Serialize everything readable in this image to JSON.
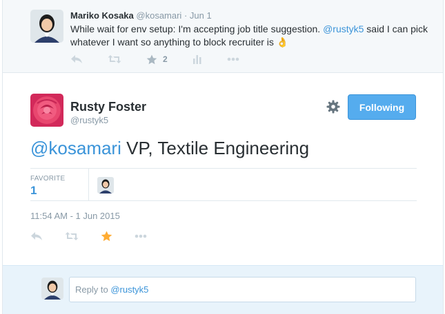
{
  "top_tweet": {
    "fullname": "Mariko Kosaka",
    "handle": "@kosamari",
    "separator": "·",
    "date": "Jun 1",
    "text_part1": "While wait for env setup: I'm accepting job title suggestion. ",
    "mention": "@rustyk5",
    "text_part2": " said I can pick whatever I want so anything to block recruiter is ",
    "emoji": "👌",
    "favorite_count": "2",
    "icons": [
      "reply-icon",
      "retweet-icon",
      "favorite-icon",
      "analytics-icon",
      "more-icon"
    ]
  },
  "main_tweet": {
    "fullname": "Rusty Foster",
    "handle": "@rustyk5",
    "follow_button": "Following",
    "text_mention": "@kosamari",
    "text_body": " VP, Textile Engineering",
    "favorite_label": "FAVORITE",
    "favorite_count": "1",
    "timestamp": "11:54 AM - 1 Jun 2015",
    "icons": [
      "reply-icon",
      "retweet-icon",
      "favorite-icon",
      "more-icon",
      "gear-icon"
    ]
  },
  "reply": {
    "placeholder": "Reply to @rustyk5"
  },
  "colors": {
    "link": "#3b94d9",
    "follow_bg": "#55acee",
    "star_active": "#ffac33",
    "muted": "#8899a6",
    "reply_bg": "#e8f3fb"
  }
}
